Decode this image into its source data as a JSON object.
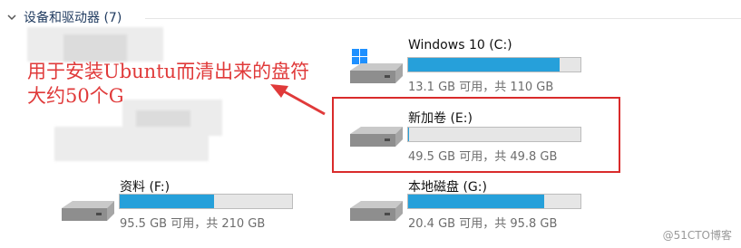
{
  "section": {
    "title": "设备和驱动器 (7)"
  },
  "drives": [
    {
      "name": "Windows 10 (C:)",
      "used_fraction": 0.881,
      "info": "13.1 GB 可用，共 110 GB"
    },
    {
      "name": "新加卷 (E:)",
      "used_fraction": 0.006,
      "info": "49.5 GB 可用，共 49.8 GB"
    },
    {
      "name": "资料 (F:)",
      "used_fraction": 0.547,
      "info": "95.5 GB 可用，共 210 GB"
    },
    {
      "name": "本地磁盘 (G:)",
      "used_fraction": 0.787,
      "info": "20.4 GB 可用，共 95.8 GB"
    }
  ],
  "annotation": {
    "line1": "用于安装Ubuntu而清出来的盘符",
    "line2": "大约50个G"
  },
  "watermark": "@51CTO博客",
  "colors": {
    "bar_fill": "#26a0da",
    "annotation": "#e03a3a",
    "highlight_border": "#d92b2b"
  },
  "icons": {
    "system_drive": "windows-logo-drive-icon",
    "drive": "hard-drive-icon"
  }
}
